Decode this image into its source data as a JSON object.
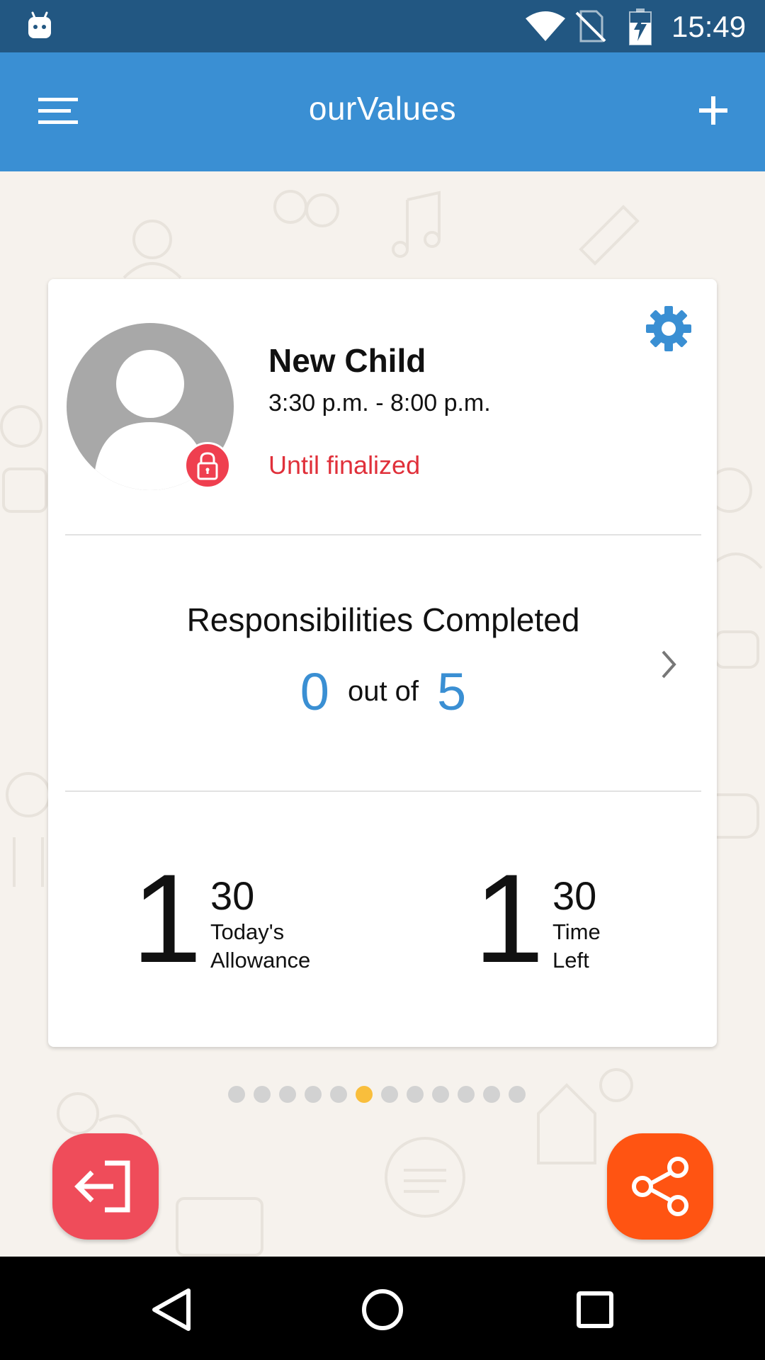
{
  "status_bar": {
    "time": "15:49",
    "icons": [
      "android-debug-icon",
      "wifi-icon",
      "no-sim-icon",
      "battery-charging-icon"
    ]
  },
  "app_bar": {
    "title": "ourValues",
    "menu_icon": "hamburger-menu-icon",
    "add_icon": "plus-icon"
  },
  "child_card": {
    "name": "New Child",
    "time_range": "3:30 p.m. - 8:00 p.m.",
    "lock_status": "Until finalized",
    "settings_icon": "gear-icon",
    "lock_icon": "padlock-icon"
  },
  "responsibilities": {
    "title": "Responsibilities Completed",
    "completed": "0",
    "separator": "out of",
    "total": "5"
  },
  "stats": [
    {
      "hours": "1",
      "minutes": "30",
      "label_line1": "Today's",
      "label_line2": "Allowance"
    },
    {
      "hours": "1",
      "minutes": "30",
      "label_line1": "Time",
      "label_line2": "Left"
    }
  ],
  "pager": {
    "count": 12,
    "active_index": 5
  },
  "actions": {
    "logout_icon": "exit-icon",
    "share_icon": "share-icon"
  },
  "colors": {
    "status_bar": "#225782",
    "app_bar": "#3a8fd3",
    "accent_blue": "#3a8fd3",
    "lock_red": "#e0303a",
    "logout_red": "#ef4c5a",
    "share_orange": "#ff5412",
    "active_dot": "#f9be3c",
    "background": "#f6f2ed"
  }
}
